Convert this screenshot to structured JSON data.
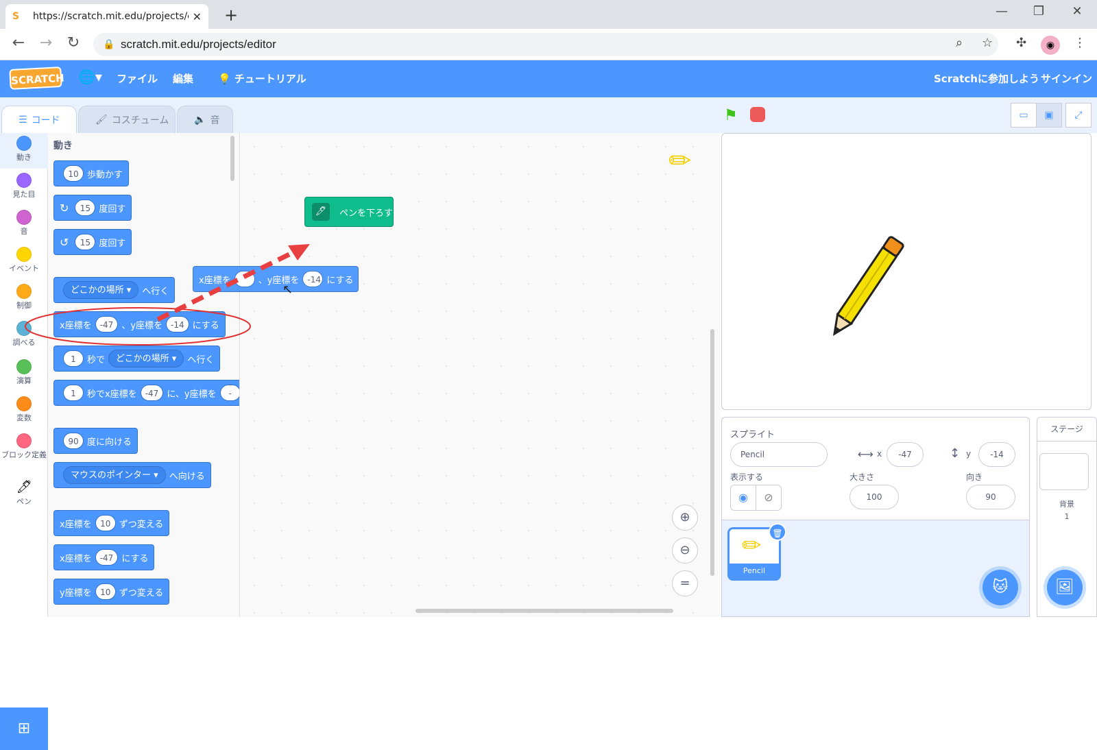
{
  "browser": {
    "tab_title": "https://scratch.mit.edu/projects/e",
    "favicon": "S",
    "url": "scratch.mit.edu/projects/editor"
  },
  "menubar": {
    "logo": "SCRATCH",
    "file": "ファイル",
    "edit": "編集",
    "tutorial": "チュートリアル",
    "join": "Scratchに参加しよう",
    "signin": "サインイン"
  },
  "editor_tabs": {
    "code": "コード",
    "costume": "コスチューム",
    "sound": "音"
  },
  "categories": [
    {
      "label": "動き",
      "color": "#4c97ff"
    },
    {
      "label": "見た目",
      "color": "#9966ff"
    },
    {
      "label": "音",
      "color": "#cf63cf"
    },
    {
      "label": "イベント",
      "color": "#ffd500"
    },
    {
      "label": "制御",
      "color": "#ffab19"
    },
    {
      "label": "調べる",
      "color": "#5cb1d6"
    },
    {
      "label": "演算",
      "color": "#59c059"
    },
    {
      "label": "変数",
      "color": "#ff8c1a"
    },
    {
      "label": "ブロック定義",
      "color": "#ff6680"
    },
    {
      "label": "ペン",
      "color": "#0fbd8c"
    }
  ],
  "palette": {
    "title": "動き",
    "move": {
      "val": "10",
      "text": "歩動かす"
    },
    "turn_right": {
      "val": "15",
      "text": "度回す"
    },
    "turn_left": {
      "val": "15",
      "text": "度回す"
    },
    "goto": {
      "dd": "どこかの場所",
      "text": "へ行く"
    },
    "gotoxy": {
      "x_label": "x座標を",
      "x": "-47",
      "sep": "、y座標を",
      "y": "-14",
      "text": "にする"
    },
    "glide": {
      "val": "1",
      "sec": "秒で",
      "dd": "どこかの場所",
      "text": "へ行く"
    },
    "glidexy": {
      "val": "1",
      "sec": "秒でx座標を",
      "x": "-47",
      "mid": "に、y座標を",
      "y": "-"
    },
    "point": {
      "val": "90",
      "text": "度に向ける"
    },
    "towards": {
      "dd": "マウスのポインター",
      "text": "へ向ける"
    },
    "changex": {
      "label": "x座標を",
      "val": "10",
      "text": "ずつ変える"
    },
    "setx": {
      "label": "x座標を",
      "val": "-47",
      "text": "にする"
    },
    "changey": {
      "label": "y座標を",
      "val": "10",
      "text": "ずつ変える"
    }
  },
  "script": {
    "pen_down": "ペンを下ろす",
    "dragging": {
      "x_label": "x座標を",
      "x": "",
      "sep": "、y座標を",
      "y": "-14",
      "text": "にする"
    }
  },
  "sprite_info": {
    "sprite_label": "スプライト",
    "name": "Pencil",
    "x_label": "x",
    "x": "-47",
    "y_label": "y",
    "y": "-14",
    "show_label": "表示する",
    "size_label": "大きさ",
    "size": "100",
    "direction_label": "向き",
    "direction": "90"
  },
  "sprite_list": [
    {
      "name": "Pencil"
    }
  ],
  "stage_pane": {
    "title": "ステージ",
    "backdrops_label": "背景",
    "backdrops_count": "1"
  },
  "colors": {
    "motion": "#4c97ff",
    "pen": "#0fbd8c",
    "menubar": "#4c97ff",
    "annotation": "#e03030"
  }
}
